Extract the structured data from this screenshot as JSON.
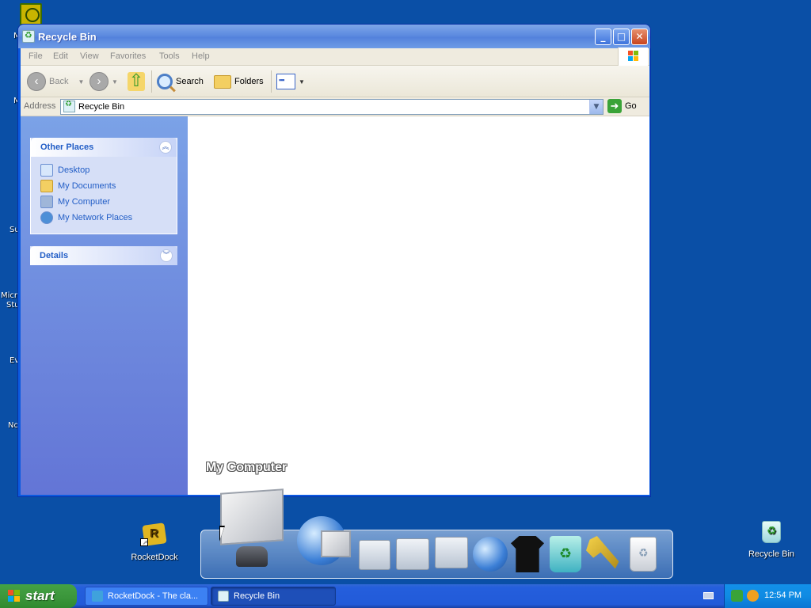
{
  "desktop": {
    "left_icon_labels": [
      "M",
      "M",
      "Su",
      "Micro",
      "Stu",
      "Ev",
      "No"
    ],
    "rocketdock_label": "RocketDock",
    "recycle_bin_label": "Recycle Bin"
  },
  "window": {
    "title": "Recycle Bin",
    "menu": [
      "File",
      "Edit",
      "View",
      "Favorites",
      "Tools",
      "Help"
    ],
    "toolbar": {
      "back": "Back",
      "search": "Search",
      "folders": "Folders"
    },
    "address": {
      "label": "Address",
      "value": "Recycle Bin",
      "go": "Go"
    },
    "other_places": {
      "title": "Other Places",
      "items": [
        "Desktop",
        "My Documents",
        "My Computer",
        "My Network Places"
      ]
    },
    "details": {
      "title": "Details"
    }
  },
  "dock": {
    "tooltip": "My Computer",
    "items": [
      "my-computer",
      "internet-explorer",
      "documents",
      "pictures",
      "network",
      "web-globe",
      "t-shirt",
      "recycle-bin-green",
      "tools",
      "trash-bin"
    ]
  },
  "taskbar": {
    "start": "start",
    "tasks": [
      "RocketDock - The cla...",
      "Recycle Bin"
    ],
    "clock": "12:54 PM"
  },
  "colors": {
    "desktop": "#0a4fa6",
    "titlebar": "#5d8be0",
    "taskbar": "#245edc",
    "start": "#3c973c",
    "link": "#215dc6"
  }
}
